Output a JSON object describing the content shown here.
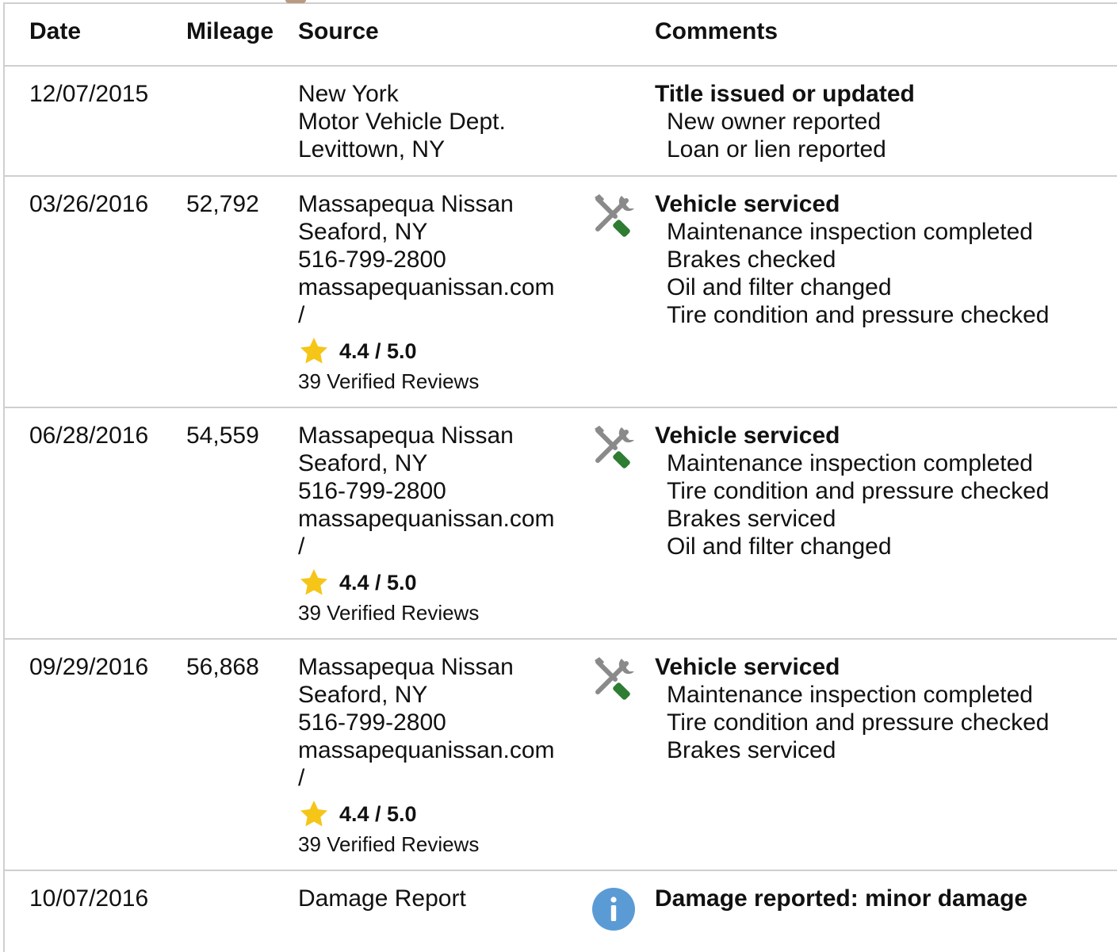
{
  "headers": {
    "date": "Date",
    "mileage": "Mileage",
    "source": "Source",
    "comments": "Comments"
  },
  "colors": {
    "star": "#F5C518",
    "info_badge": "#5B9BD5",
    "tool_green": "#2E7D32",
    "tool_gray": "#8A8A8A"
  },
  "records": [
    {
      "date": "12/07/2015",
      "mileage": "",
      "source": [
        "New York",
        "Motor Vehicle Dept.",
        "Levittown, NY"
      ],
      "icon": "",
      "comment_title": "Title issued or updated",
      "comment_items": [
        "New owner reported",
        "Loan or lien reported"
      ]
    },
    {
      "date": "03/26/2016",
      "mileage": "52,792",
      "source": [
        "Massapequa Nissan",
        "Seaford, NY",
        "516-799-2800",
        "massapequanissan.com",
        "/"
      ],
      "rating": "4.4 / 5.0",
      "reviews": "39 Verified Reviews",
      "icon": "service-tools-icon",
      "comment_title": "Vehicle serviced",
      "comment_items": [
        "Maintenance inspection completed",
        "Brakes checked",
        "Oil and filter changed",
        "Tire condition and pressure checked"
      ]
    },
    {
      "date": "06/28/2016",
      "mileage": "54,559",
      "source": [
        "Massapequa Nissan",
        "Seaford, NY",
        "516-799-2800",
        "massapequanissan.com",
        "/"
      ],
      "rating": "4.4 / 5.0",
      "reviews": "39 Verified Reviews",
      "icon": "service-tools-icon",
      "comment_title": "Vehicle serviced",
      "comment_items": [
        "Maintenance inspection completed",
        "Tire condition and pressure checked",
        "Brakes serviced",
        "Oil and filter changed"
      ]
    },
    {
      "date": "09/29/2016",
      "mileage": "56,868",
      "source": [
        "Massapequa Nissan",
        "Seaford, NY",
        "516-799-2800",
        "massapequanissan.com",
        "/"
      ],
      "rating": "4.4 / 5.0",
      "reviews": "39 Verified Reviews",
      "icon": "service-tools-icon",
      "comment_title": "Vehicle serviced",
      "comment_items": [
        "Maintenance inspection completed",
        "Tire condition and pressure checked",
        "Brakes serviced"
      ]
    },
    {
      "date": "10/07/2016",
      "mileage": "",
      "source": [
        "Damage Report"
      ],
      "icon": "info-icon",
      "comment_title": "Damage reported: minor damage",
      "comment_items": []
    }
  ]
}
